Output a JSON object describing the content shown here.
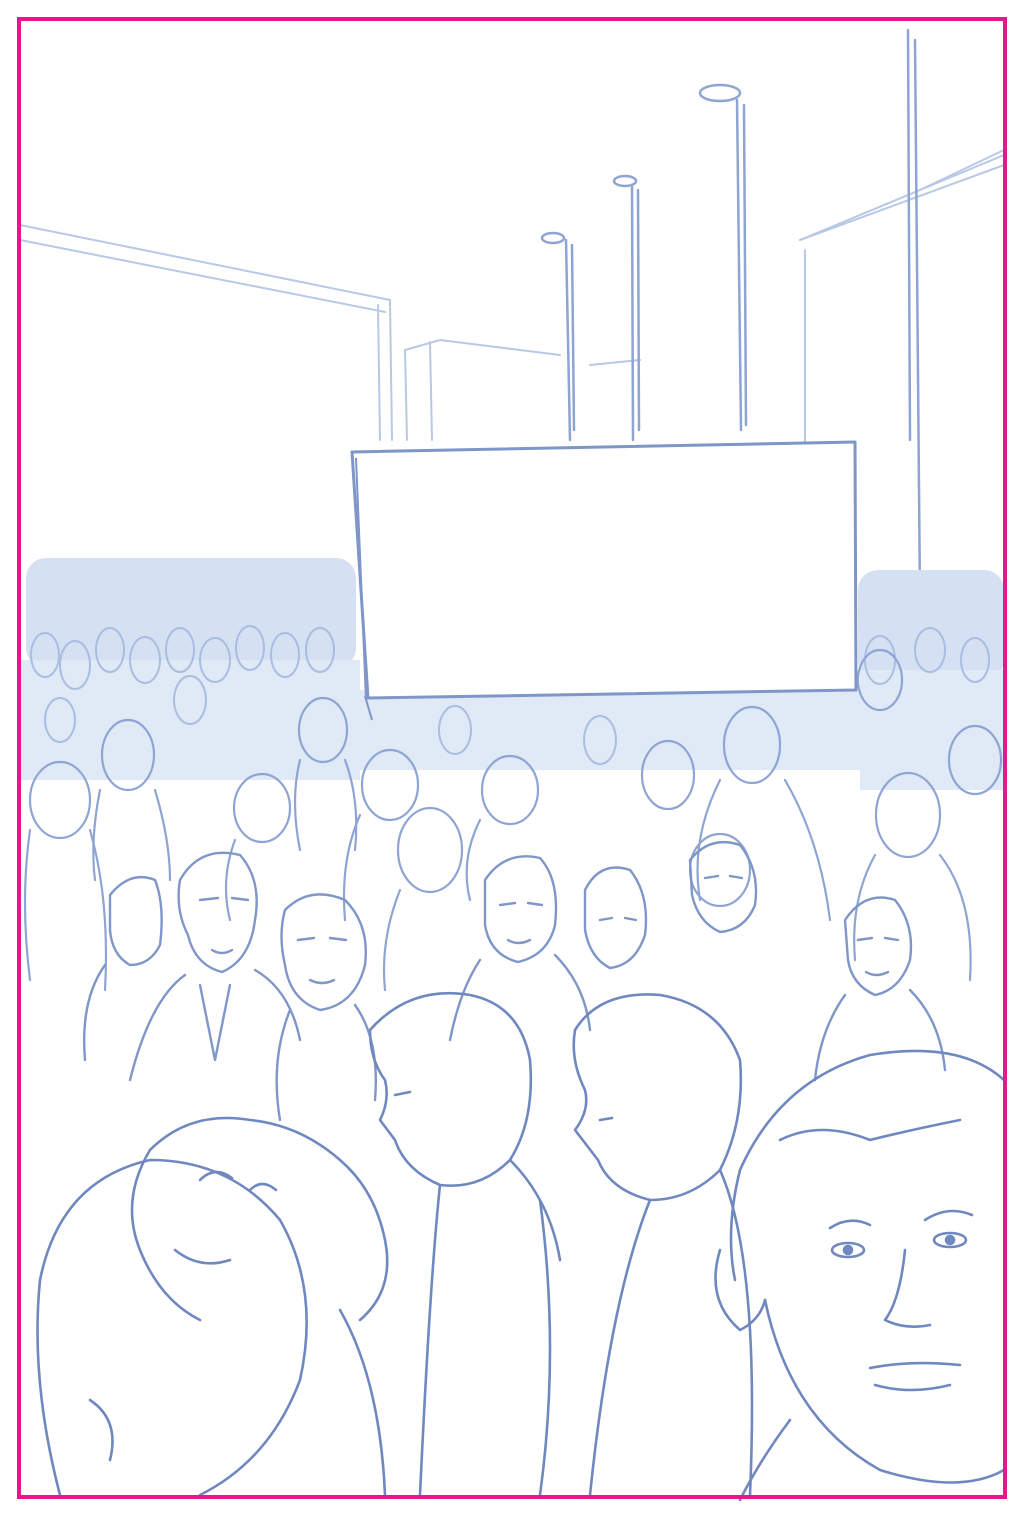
{
  "image": {
    "kind": "pencil-sketch",
    "subject": "crowd-scene-with-blank-screen",
    "line_color": "#8aa2d0",
    "line_color_dark": "#6f88c0",
    "fill_color": "#c9d8ee",
    "frame_color": "#e6178e"
  }
}
